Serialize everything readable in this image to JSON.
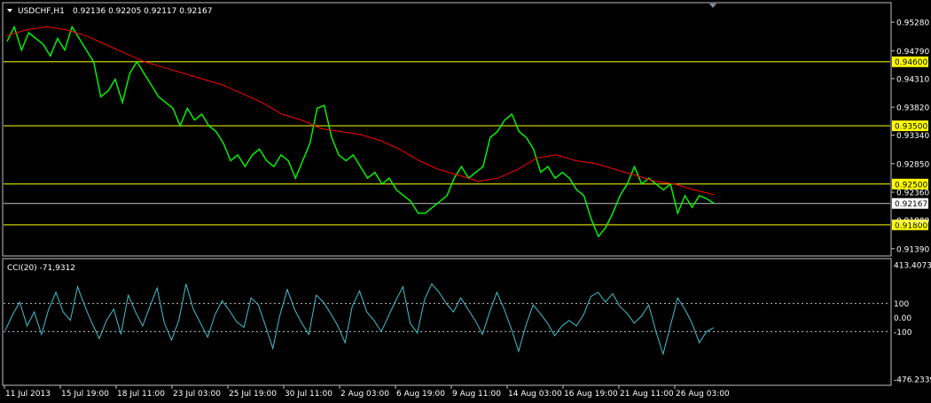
{
  "header": {
    "symbol": "USDCHF,H1",
    "ohlc": "0.92136 0.92205 0.92117 0.92167"
  },
  "colors": {
    "background": "#000000",
    "frame": "#c0c0c0",
    "price": "#00ff00",
    "ma": "#ff0000",
    "hline": "#ffff00",
    "hline_label_bg": "#ffff00",
    "current_price_line": "#c0c0c0",
    "cci": "#40c0d0",
    "text": "#ffffff"
  },
  "chart_data": [
    {
      "type": "line",
      "panel": "price",
      "ylim": [
        0.9128,
        0.956
      ],
      "yticks": [
        "0.95280",
        "0.94790",
        "0.94310",
        "0.93820",
        "0.93340",
        "0.92850",
        "0.92360",
        "0.91880",
        "0.91390"
      ],
      "x_ticks": [
        "11 Jul 2013",
        "15 Jul 19:00",
        "18 Jul 11:00",
        "23 Jul 03:00",
        "25 Jul 19:00",
        "30 Jul 11:00",
        "2 Aug 03:00",
        "6 Aug 19:00",
        "9 Aug 11:00",
        "14 Aug 03:00",
        "16 Aug 19:00",
        "21 Aug 11:00",
        "26 Aug 03:00"
      ],
      "horizontal_levels": [
        "0.94600",
        "0.93500",
        "0.92500",
        "0.91800"
      ],
      "current_price": "0.92167",
      "series": [
        {
          "values": [
            0.9495,
            0.952,
            0.948,
            0.951,
            0.95,
            0.949,
            0.947,
            0.95,
            0.948,
            0.952,
            0.95,
            0.948,
            0.946,
            0.94,
            0.941,
            0.943,
            0.939,
            0.944,
            0.946,
            0.944,
            0.942,
            0.94,
            0.939,
            0.938,
            0.935,
            0.938,
            0.936,
            0.937,
            0.935,
            0.934,
            0.932,
            0.929,
            0.93,
            0.928,
            0.93,
            0.931,
            0.929,
            0.928,
            0.93,
            0.929,
            0.926,
            0.929,
            0.932,
            0.938,
            0.9385,
            0.933,
            0.93,
            0.929,
            0.93,
            0.928,
            0.926,
            0.927,
            0.925,
            0.926,
            0.924,
            0.923,
            0.922,
            0.92,
            0.92,
            0.921,
            0.922,
            0.923,
            0.926,
            0.928,
            0.926,
            0.927,
            0.928,
            0.933,
            0.934,
            0.936,
            0.937,
            0.934,
            0.933,
            0.931,
            0.927,
            0.928,
            0.926,
            0.927,
            0.926,
            0.924,
            0.923,
            0.919,
            0.916,
            0.9175,
            0.92,
            0.923,
            0.925,
            0.928,
            0.925,
            0.926,
            0.925,
            0.924,
            0.925,
            0.92,
            0.923,
            0.921,
            0.923,
            0.9225,
            0.9217
          ]
        },
        {
          "values": [
            0.9505,
            0.9515,
            0.952,
            0.9515,
            0.9505,
            0.949,
            0.9475,
            0.946,
            0.945,
            0.944,
            0.943,
            0.942,
            0.9405,
            0.939,
            0.937,
            0.936,
            0.9345,
            0.934,
            0.9335,
            0.9325,
            0.931,
            0.929,
            0.9275,
            0.9265,
            0.9255,
            0.926,
            0.9275,
            0.9295,
            0.93,
            0.929,
            0.9285,
            0.9275,
            0.9265,
            0.9255,
            0.925,
            0.924,
            0.9232
          ]
        }
      ]
    },
    {
      "type": "line",
      "panel": "indicator",
      "title": "CCI(20) -71,9312",
      "ylim": [
        -476.2339,
        413.4073
      ],
      "yticks": [
        "413.4073",
        "100",
        "0.00",
        "-100",
        "-476.2339"
      ],
      "dashed_levels": [
        100,
        -100
      ],
      "series": [
        {
          "values": [
            -90,
            20,
            110,
            -60,
            40,
            -120,
            60,
            180,
            40,
            -20,
            220,
            80,
            -40,
            -150,
            -20,
            60,
            -120,
            160,
            40,
            -60,
            80,
            210,
            -40,
            -160,
            -20,
            240,
            60,
            -40,
            -140,
            20,
            120,
            50,
            -30,
            -70,
            140,
            90,
            -60,
            -220,
            20,
            200,
            60,
            -40,
            -120,
            160,
            110,
            30,
            -60,
            -180,
            80,
            190,
            40,
            -20,
            -100,
            10,
            120,
            220,
            -40,
            -110,
            130,
            240,
            180,
            100,
            40,
            140,
            60,
            -20,
            -120,
            40,
            180,
            60,
            -80,
            -240,
            -60,
            90,
            30,
            -40,
            -130,
            -60,
            -20,
            -60,
            20,
            150,
            180,
            110,
            170,
            80,
            30,
            -40,
            10,
            90,
            -100,
            -260,
            -60,
            140,
            60,
            -40,
            -180,
            -100,
            -72
          ]
        }
      ]
    }
  ]
}
